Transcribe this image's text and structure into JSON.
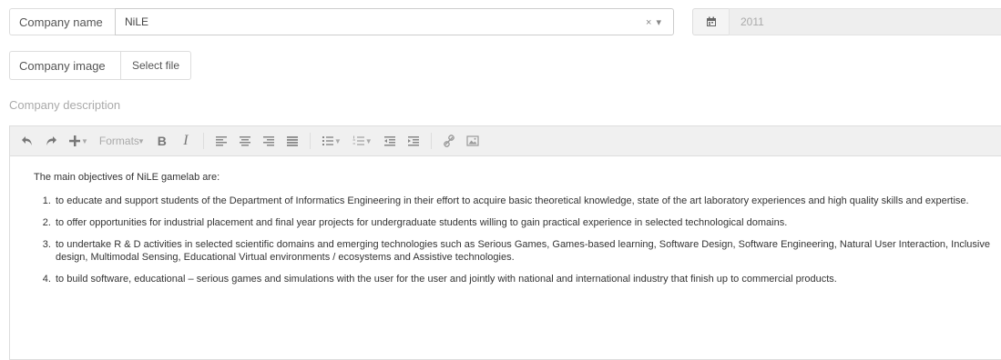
{
  "company": {
    "name_label": "Company name",
    "name_value": "NiLE",
    "select_controls": "× ▾",
    "year_placeholder": "2011",
    "image_label": "Company image",
    "select_file_label": "Select file",
    "description_label": "Company description"
  },
  "toolbar": {
    "formats_label": "Formats",
    "bold_label": "B",
    "italic_label": "I"
  },
  "editor": {
    "intro": "The main objectives of NiLE gamelab are:",
    "items": [
      "to educate and support students of the Department of Informatics Engineering in their effort to acquire basic theoretical knowledge, state of the art laboratory experiences and high quality skills and expertise.",
      "to offer opportunities for industrial placement and final year projects for undergraduate students willing to gain practical experience in selected technological domains.",
      "to undertake R & D activities in selected scientific domains and emerging technologies such as Serious Games, Games-based learning, Software Design, Software Engineering, Natural User Interaction, Inclusive design, Multimodal Sensing, Educational Virtual environments / ecosystems and Assistive technologies.",
      "to build software, educational – serious games and simulations with the user for the user and jointly with national and international industry that finish up to commercial products."
    ]
  }
}
